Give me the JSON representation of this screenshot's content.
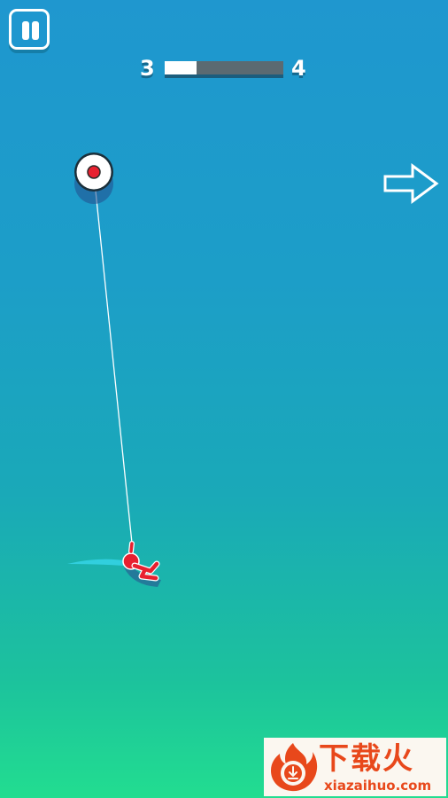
{
  "hud": {
    "pause_icon": "pause-icon",
    "current_level": "3",
    "next_level": "4",
    "level_progress": 0.27
  },
  "hint": {
    "icon": "right-arrow-icon"
  },
  "game": {
    "anchor_icon": "target-anchor-icon",
    "player_icon": "stickman-hero-icon",
    "rope_color": "#ffffff",
    "player_color": "#e8202f",
    "anchor_dot_color": "#e8202f"
  },
  "watermark": {
    "name": "下载火",
    "domain": "xiazaihuo.com",
    "logo_icon": "flame-logo-icon",
    "brand_color": "#e8481b"
  }
}
